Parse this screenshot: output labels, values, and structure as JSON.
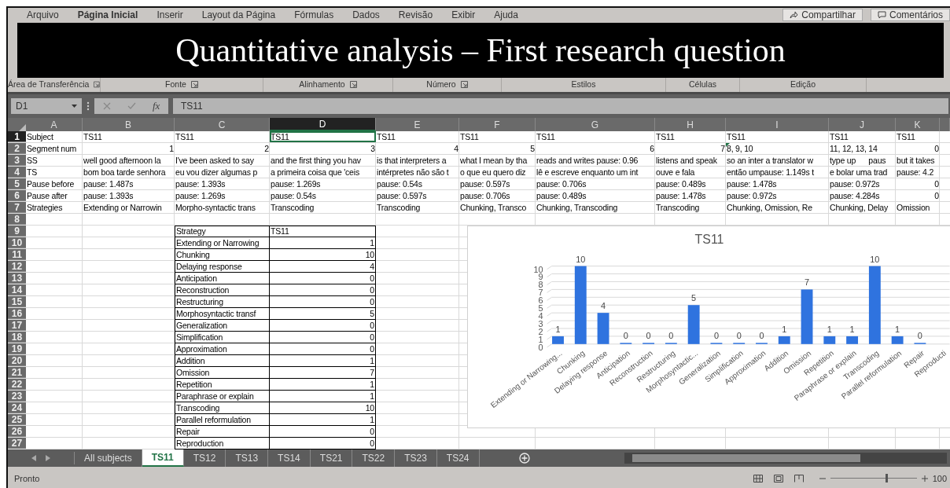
{
  "menu": {
    "tabs": [
      {
        "label": "Arquivo",
        "selected": false
      },
      {
        "label": "Página Inicial",
        "selected": true
      },
      {
        "label": "Inserir",
        "selected": false
      },
      {
        "label": "Layout da Página",
        "selected": false
      },
      {
        "label": "Fórmulas",
        "selected": false
      },
      {
        "label": "Dados",
        "selected": false
      },
      {
        "label": "Revisão",
        "selected": false
      },
      {
        "label": "Exibir",
        "selected": false
      },
      {
        "label": "Ajuda",
        "selected": false
      }
    ],
    "share_button": "Compartilhar",
    "comments_button": "Comentários"
  },
  "banner": {
    "title": "Quantitative analysis – First research question"
  },
  "ribbon": {
    "groups": [
      {
        "label": "Área de Transferência",
        "launcher": true
      },
      {
        "label": "Fonte",
        "launcher": true
      },
      {
        "label": "Alinhamento",
        "launcher": true
      },
      {
        "label": "Número",
        "launcher": true
      },
      {
        "label": "Estilos",
        "launcher": false
      },
      {
        "label": "Células",
        "launcher": false
      },
      {
        "label": "Edição",
        "launcher": false
      }
    ]
  },
  "formula_bar": {
    "name_box": "D1",
    "function_label": "fx",
    "value": "TS11"
  },
  "sheet": {
    "columns": [
      {
        "label": "A",
        "selected": false
      },
      {
        "label": "B",
        "selected": false
      },
      {
        "label": "C",
        "selected": false
      },
      {
        "label": "D",
        "selected": true
      },
      {
        "label": "E",
        "selected": false
      },
      {
        "label": "F",
        "selected": false
      },
      {
        "label": "G",
        "selected": false
      },
      {
        "label": "H",
        "selected": false
      },
      {
        "label": "I",
        "selected": false
      },
      {
        "label": "J",
        "selected": false
      },
      {
        "label": "K",
        "selected": false
      }
    ],
    "rows": [
      {
        "number": "1",
        "selected": true,
        "cells": [
          "Subject",
          "TS11",
          "TS11",
          "TS11",
          "TS11",
          "TS11",
          "TS11",
          "TS11",
          "TS11",
          "TS11",
          "TS11"
        ]
      },
      {
        "number": "2",
        "selected": false,
        "cells": [
          "Segment num",
          {
            "value": "1",
            "kind": "number"
          },
          {
            "value": "2",
            "kind": "number"
          },
          {
            "value": "3",
            "kind": "number"
          },
          {
            "value": "4",
            "kind": "number"
          },
          {
            "value": "5",
            "kind": "number"
          },
          {
            "value": "6",
            "kind": "number"
          },
          {
            "value": "7",
            "kind": "number"
          },
          {
            "value": "8, 9, 10",
            "kind": "text",
            "flagged": true
          },
          "11, 12, 13, 14",
          {
            "value": "0",
            "kind": "number"
          }
        ]
      },
      {
        "number": "3",
        "selected": false,
        "cells": [
          "SS",
          "well good afternoon la",
          "I've been asked to say",
          "and the first thing you hav",
          "is that interpreters a",
          "what I mean by tha",
          "reads and writes pause: 0.96",
          "listens and speak",
          "so an inter a translator w",
          "type up      paus",
          "but it takes"
        ]
      },
      {
        "number": "4",
        "selected": false,
        "cells": [
          "TS",
          "bom boa tarde senhora",
          "eu vou dizer algumas p",
          "a primeira coisa que 'ceis",
          "intérpretes não são t",
          "o que eu quero diz",
          "lê e escreve enquanto um int",
          "ouve e fala",
          "então umpause: 1.149s t",
          "e bolar uma trad",
          "pause: 4.2"
        ]
      },
      {
        "number": "5",
        "selected": false,
        "cells": [
          "Pause before",
          "pause: 1.487s",
          "pause: 1.393s",
          "pause: 1.269s",
          "pause: 0.54s",
          "pause: 0.597s",
          "pause: 0.706s",
          "pause: 0.489s",
          "pause: 1.478s",
          "pause: 0.972s",
          {
            "value": "0",
            "kind": "number"
          }
        ]
      },
      {
        "number": "6",
        "selected": false,
        "cells": [
          "Pause after",
          "pause: 1.393s",
          "pause: 1.269s",
          "pause: 0.54s",
          "pause: 0.597s",
          "pause: 0.706s",
          "pause: 0.489s",
          "pause: 1.478s",
          "pause: 0.972s",
          "pause: 4.284s",
          {
            "value": "0",
            "kind": "number"
          }
        ]
      },
      {
        "number": "7",
        "selected": false,
        "cells": [
          "Strategies",
          "Extending or Narrowin",
          "Morpho-syntactic trans",
          "Transcoding",
          "Transcoding",
          "Chunking, Transco",
          "Chunking, Transcoding",
          "Transcoding",
          "Chunking, Omission, Re",
          "Chunking, Delay",
          "Omission"
        ]
      },
      {
        "number": "8",
        "selected": false
      },
      {
        "number": "9",
        "selected": false,
        "table_cells": [
          "Strategy",
          "TS11"
        ]
      },
      {
        "number": "10",
        "selected": false,
        "table_cells": [
          "Extending or Narrowing",
          {
            "value": "1",
            "kind": "number"
          }
        ]
      },
      {
        "number": "11",
        "selected": false,
        "table_cells": [
          "Chunking",
          {
            "value": "10",
            "kind": "number"
          }
        ]
      },
      {
        "number": "12",
        "selected": false,
        "table_cells": [
          "Delaying response",
          {
            "value": "4",
            "kind": "number"
          }
        ]
      },
      {
        "number": "13",
        "selected": false,
        "table_cells": [
          "Anticipation",
          {
            "value": "0",
            "kind": "number"
          }
        ]
      },
      {
        "number": "14",
        "selected": false,
        "table_cells": [
          "Reconstruction",
          {
            "value": "0",
            "kind": "number"
          }
        ]
      },
      {
        "number": "15",
        "selected": false,
        "table_cells": [
          "Restructuring",
          {
            "value": "0",
            "kind": "number"
          }
        ]
      },
      {
        "number": "16",
        "selected": false,
        "table_cells": [
          "Morphosyntactic transf",
          {
            "value": "5",
            "kind": "number"
          }
        ]
      },
      {
        "number": "17",
        "selected": false,
        "table_cells": [
          "Generalization",
          {
            "value": "0",
            "kind": "number"
          }
        ]
      },
      {
        "number": "18",
        "selected": false,
        "table_cells": [
          "Simplification",
          {
            "value": "0",
            "kind": "number"
          }
        ]
      },
      {
        "number": "19",
        "selected": false,
        "table_cells": [
          "Approximation",
          {
            "value": "0",
            "kind": "number"
          }
        ]
      },
      {
        "number": "20",
        "selected": false,
        "table_cells": [
          "Addition",
          {
            "value": "1",
            "kind": "number"
          }
        ]
      },
      {
        "number": "21",
        "selected": false,
        "table_cells": [
          "Omission",
          {
            "value": "7",
            "kind": "number"
          }
        ]
      },
      {
        "number": "22",
        "selected": false,
        "table_cells": [
          "Repetition",
          {
            "value": "1",
            "kind": "number"
          }
        ]
      },
      {
        "number": "23",
        "selected": false,
        "table_cells": [
          "Paraphrase or explain",
          {
            "value": "1",
            "kind": "number"
          }
        ]
      },
      {
        "number": "24",
        "selected": false,
        "table_cells": [
          "Transcoding",
          {
            "value": "10",
            "kind": "number"
          }
        ]
      },
      {
        "number": "25",
        "selected": false,
        "table_cells": [
          "Parallel reformulation",
          {
            "value": "1",
            "kind": "number"
          }
        ]
      },
      {
        "number": "26",
        "selected": false,
        "table_cells": [
          "Repair",
          {
            "value": "0",
            "kind": "number"
          }
        ]
      },
      {
        "number": "27",
        "selected": false,
        "table_cells": [
          "Reproduction",
          {
            "value": "0",
            "kind": "number"
          }
        ]
      }
    ],
    "chart_data": {
      "type": "bar",
      "title": "TS11",
      "categories": [
        "Extending or Narrowing...",
        "Chunking",
        "Delaying response",
        "Anticipation",
        "Reconstruction",
        "Restructuring",
        "Morphosyntactic...",
        "Generalization",
        "Simplification",
        "Approximation",
        "Addition",
        "Omission",
        "Repetition",
        "Paraphrase or explain",
        "Transcoding",
        "Parallel reformulation",
        "Repair",
        "Reproducti"
      ],
      "values": [
        1,
        10,
        4,
        0,
        0,
        0,
        5,
        0,
        0,
        0,
        1,
        7,
        1,
        1,
        10,
        1,
        0,
        null
      ],
      "ylim": [
        0,
        10
      ],
      "grid": true,
      "yticks": [
        0,
        1,
        2,
        3,
        4,
        5,
        6,
        7,
        8,
        9,
        10
      ],
      "data_labels": true
    }
  },
  "sheet_tabs": [
    {
      "label": "All subjects",
      "selected": false
    },
    {
      "label": "TS11",
      "selected": true
    },
    {
      "label": "TS12",
      "selected": false
    },
    {
      "label": "TS13",
      "selected": false
    },
    {
      "label": "TS14",
      "selected": false
    },
    {
      "label": "TS21",
      "selected": false
    },
    {
      "label": "TS22",
      "selected": false
    },
    {
      "label": "TS23",
      "selected": false
    },
    {
      "label": "TS24",
      "selected": false
    }
  ],
  "status_bar": {
    "status": "Pronto",
    "zoom": "100"
  }
}
